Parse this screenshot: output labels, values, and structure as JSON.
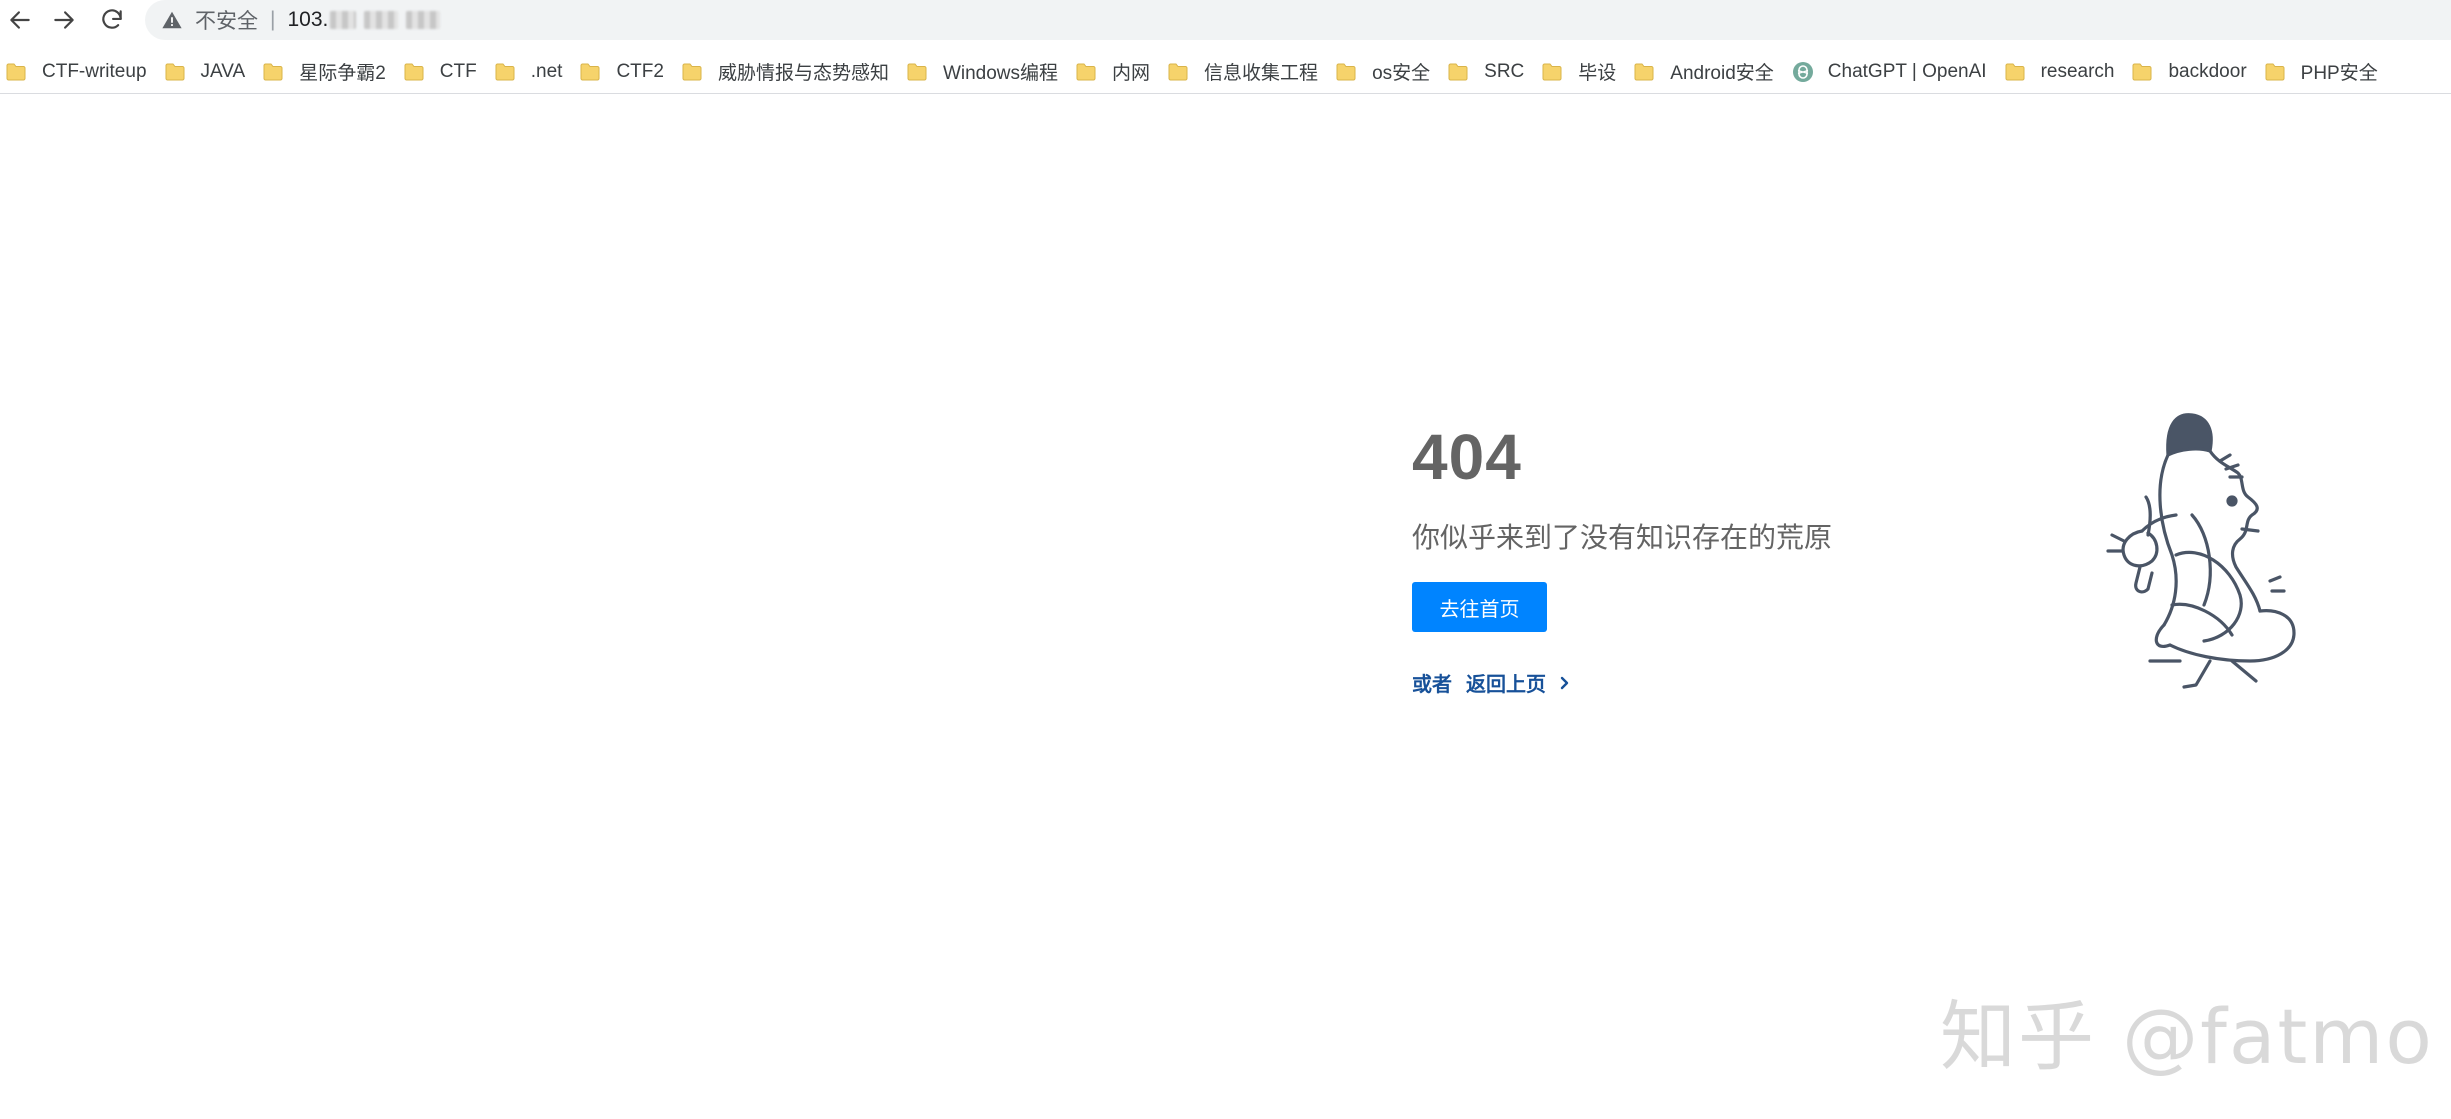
{
  "browser": {
    "security_label": "不安全",
    "separator": "|",
    "url_prefix": "103.",
    "icons": {
      "back": "arrow-left-icon",
      "forward": "arrow-right-icon",
      "reload": "reload-icon",
      "security": "warning-triangle-icon"
    }
  },
  "bookmarks": [
    {
      "label": "CTF-writeup",
      "icon": "folder"
    },
    {
      "label": "JAVA",
      "icon": "folder"
    },
    {
      "label": "星际争霸2",
      "icon": "folder"
    },
    {
      "label": "CTF",
      "icon": "folder"
    },
    {
      "label": ".net",
      "icon": "folder"
    },
    {
      "label": "CTF2",
      "icon": "folder"
    },
    {
      "label": "威胁情报与态势感知",
      "icon": "folder"
    },
    {
      "label": "Windows编程",
      "icon": "folder"
    },
    {
      "label": "内网",
      "icon": "folder"
    },
    {
      "label": "信息收集工程",
      "icon": "folder"
    },
    {
      "label": "os安全",
      "icon": "folder"
    },
    {
      "label": "SRC",
      "icon": "folder"
    },
    {
      "label": "毕设",
      "icon": "folder"
    },
    {
      "label": "Android安全",
      "icon": "folder"
    },
    {
      "label": "ChatGPT | OpenAI",
      "icon": "openai"
    },
    {
      "label": "research",
      "icon": "folder"
    },
    {
      "label": "backdoor",
      "icon": "folder"
    },
    {
      "label": "PHP安全",
      "icon": "folder"
    }
  ],
  "error": {
    "code": "404",
    "message": "你似乎来到了没有知识存在的荒原",
    "home_button": "去往首页",
    "or_label": "或者",
    "back_label": "返回上页"
  },
  "colors": {
    "primary_button": "#0084ff",
    "link": "#175199",
    "text": "#646464",
    "folder": "#f6d36b"
  },
  "watermark": "知乎 @fatmo"
}
